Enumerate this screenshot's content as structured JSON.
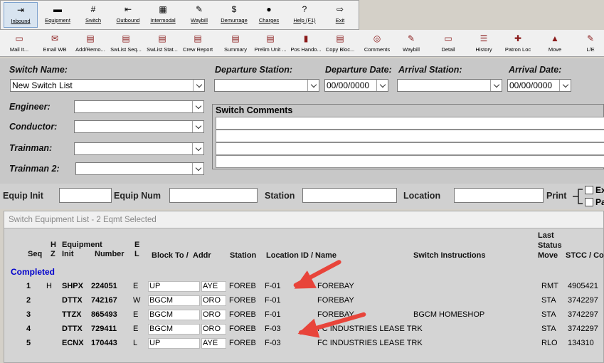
{
  "toolbar1": {
    "items": [
      {
        "label": "Inbound",
        "icon": "inbound-icon",
        "glyph": "⇥"
      },
      {
        "label": "Equipment",
        "icon": "equipment-icon",
        "glyph": "▬"
      },
      {
        "label": "Switch",
        "icon": "switch-icon",
        "glyph": "#"
      },
      {
        "label": "Outbound",
        "icon": "outbound-icon",
        "glyph": "⇤"
      },
      {
        "label": "Intermodal",
        "icon": "intermodal-icon",
        "glyph": "▦"
      },
      {
        "label": "Waybill",
        "icon": "waybill-icon",
        "glyph": "✎"
      },
      {
        "label": "Demurrage",
        "icon": "demurrage-icon",
        "glyph": "$"
      },
      {
        "label": "Charges",
        "icon": "charges-icon",
        "glyph": "●"
      },
      {
        "label": "Help (F1)",
        "icon": "help-icon",
        "glyph": "?"
      },
      {
        "label": "Exit",
        "icon": "exit-icon",
        "glyph": "⇨"
      }
    ]
  },
  "toolbar2": {
    "items": [
      {
        "label": "Mail It...",
        "icon": "mail-icon",
        "glyph": "▭"
      },
      {
        "label": "Email WB",
        "icon": "email-icon",
        "glyph": "✉"
      },
      {
        "label": "Add/Remo...",
        "icon": "add-remove-icon",
        "glyph": "▤"
      },
      {
        "label": "SwList Seq...",
        "icon": "swlist-seq-icon",
        "glyph": "▤"
      },
      {
        "label": "SwList Stat...",
        "icon": "swlist-stat-icon",
        "glyph": "▤"
      },
      {
        "label": "Crew Report",
        "icon": "crew-report-icon",
        "glyph": "▤"
      },
      {
        "label": "Summary",
        "icon": "summary-icon",
        "glyph": "▤"
      },
      {
        "label": "Prelim Unit ...",
        "icon": "prelim-unit-icon",
        "glyph": "▤"
      },
      {
        "label": "Pos Hando...",
        "icon": "pos-handoff-icon",
        "glyph": "▮"
      },
      {
        "label": "Copy Bloc...",
        "icon": "copy-block-icon",
        "glyph": "▤"
      },
      {
        "label": "Comments",
        "icon": "comments-icon",
        "glyph": "◎"
      },
      {
        "label": "Waybill",
        "icon": "waybill2-icon",
        "glyph": "✎"
      },
      {
        "label": "Detail",
        "icon": "detail-icon",
        "glyph": "▭"
      },
      {
        "label": "History",
        "icon": "history-icon",
        "glyph": "☰"
      },
      {
        "label": "Patron Loc",
        "icon": "patron-loc-icon",
        "glyph": "✚"
      },
      {
        "label": "Move",
        "icon": "move-icon",
        "glyph": "▲"
      },
      {
        "label": "L/E",
        "icon": "le-icon",
        "glyph": "✎"
      }
    ]
  },
  "form": {
    "switch_name_label": "Switch Name:",
    "switch_name_value": "New Switch List",
    "departure_station_label": "Departure Station:",
    "departure_station_value": "",
    "departure_date_label": "Departure Date:",
    "departure_date_value": "00/00/0000",
    "arrival_station_label": "Arrival Station:",
    "arrival_station_value": "",
    "arrival_date_label": "Arrival Date:",
    "arrival_date_value": "00/00/0000",
    "engineer_label": "Engineer:",
    "conductor_label": "Conductor:",
    "trainman_label": "Trainman:",
    "trainman2_label": "Trainman 2:",
    "comments_label": "Switch Comments"
  },
  "equip_bar": {
    "equip_init_label": "Equip Init",
    "equip_num_label": "Equip Num",
    "station_label": "Station",
    "location_label": "Location",
    "print_label": "Print",
    "opt1": "Ex",
    "opt2": "Pa"
  },
  "list": {
    "title": "Switch Equipment List - 2 Eqmt Selected",
    "headers": {
      "seq": "Seq",
      "h": "H",
      "z": "Z",
      "equipment": "Equipment",
      "init": "Init",
      "number": "Number",
      "e": "E",
      "l": "L",
      "block_to": "Block To /",
      "addr": "Addr",
      "station": "Station",
      "location": "Location ID / Name",
      "instructions": "Switch Instructions",
      "last": "Last",
      "status": "Status",
      "move": "Move",
      "stcc": "STCC / Co"
    },
    "group": "Completed",
    "rows": [
      {
        "seq": "1",
        "hz": "H",
        "init": "SHPX",
        "number": "224051",
        "el": "E",
        "block": "UP",
        "addr": "AYE",
        "station": "FOREB",
        "loc_id": "F-01",
        "loc_name": "FOREBAY",
        "instr": "",
        "move": "RMT",
        "stcc": "4905421"
      },
      {
        "seq": "2",
        "hz": "",
        "init": "DTTX",
        "number": "742167",
        "el": "W",
        "block": "BGCM",
        "addr": "ORO",
        "station": "FOREB",
        "loc_id": "F-01",
        "loc_name": "FOREBAY",
        "instr": "",
        "move": "STA",
        "stcc": "3742297"
      },
      {
        "seq": "3",
        "hz": "",
        "init": "TTZX",
        "number": "865493",
        "el": "E",
        "block": "BGCM",
        "addr": "ORO",
        "station": "FOREB",
        "loc_id": "F-01",
        "loc_name": "FOREBAY",
        "instr": "BGCM HOMESHOP",
        "move": "STA",
        "stcc": "3742297"
      },
      {
        "seq": "4",
        "hz": "",
        "init": "DTTX",
        "number": "729411",
        "el": "E",
        "block": "BGCM",
        "addr": "ORO",
        "station": "FOREB",
        "loc_id": "F-03",
        "loc_name": "FC INDUSTRIES LEASE TRK",
        "instr": "",
        "move": "STA",
        "stcc": "3742297"
      },
      {
        "seq": "5",
        "hz": "",
        "init": "ECNX",
        "number": "170443",
        "el": "L",
        "block": "UP",
        "addr": "AYE",
        "station": "FOREB",
        "loc_id": "F-03",
        "loc_name": "FC INDUSTRIES LEASE TRK",
        "instr": "",
        "move": "RLO",
        "stcc": "134310"
      }
    ]
  },
  "colors": {
    "group": "#0000cc",
    "arrow": "#e8443a"
  }
}
